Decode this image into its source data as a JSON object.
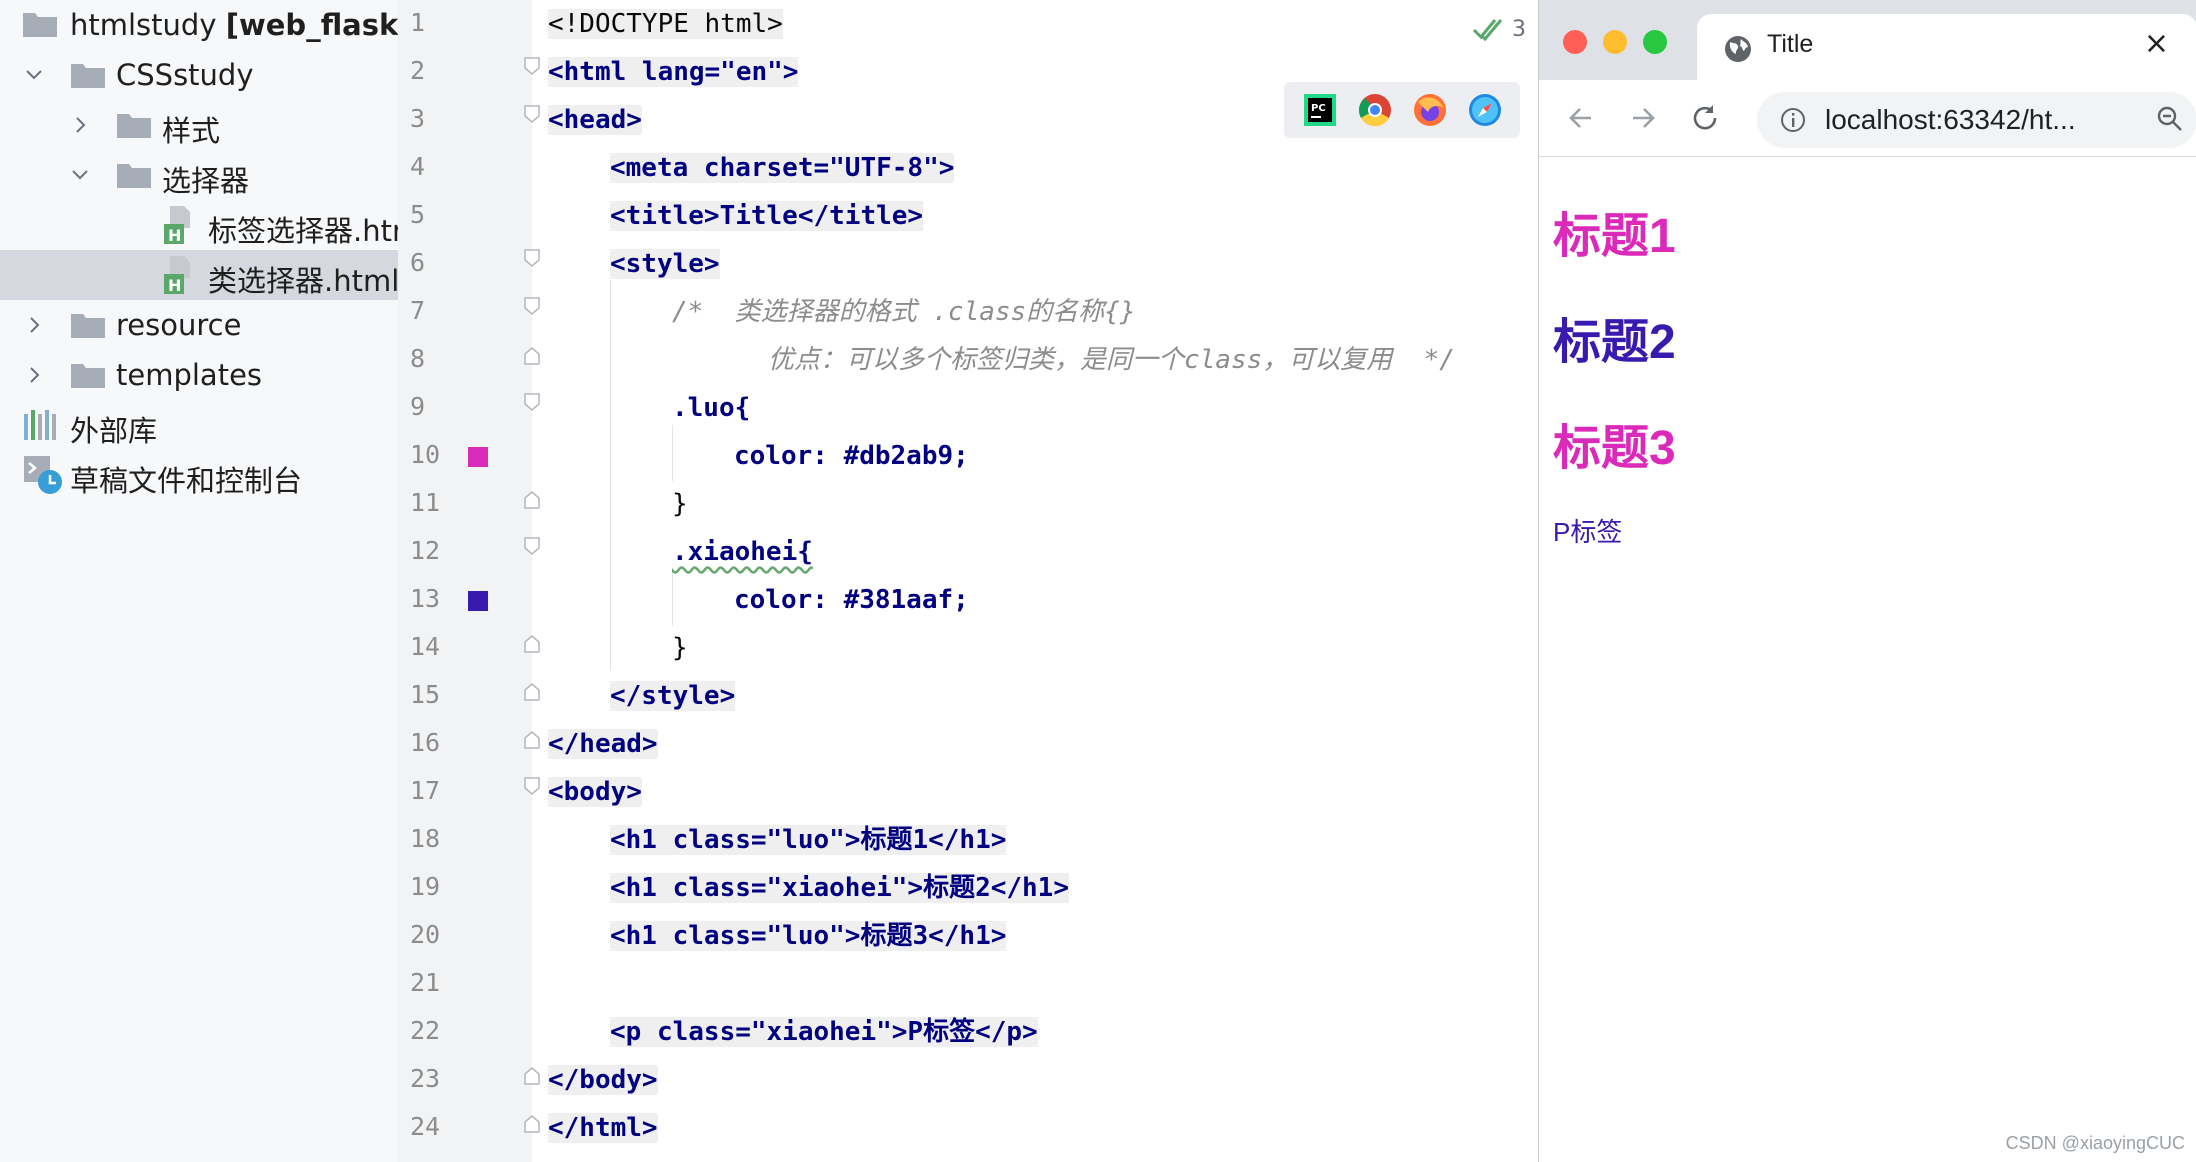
{
  "project_tree": {
    "root": {
      "name": "htmlstudy",
      "module": "[web_flask]"
    },
    "items": [
      {
        "label": "CSSstudy"
      },
      {
        "label": "样式"
      },
      {
        "label": "选择器"
      },
      {
        "label": "标签选择器.html"
      },
      {
        "label": "类选择器.html"
      },
      {
        "label": "resource"
      },
      {
        "label": "templates"
      },
      {
        "label": "外部库"
      },
      {
        "label": "草稿文件和控制台"
      }
    ]
  },
  "editor": {
    "inspection_count": "3",
    "colors": {
      "luo": "#db2ab9",
      "xiaohei": "#381aaf"
    },
    "code": {
      "l1": "<!DOCTYPE html>",
      "l2": "<html lang=\"en\">",
      "l3": "<head>",
      "l4": "<meta charset=\"UTF-8\">",
      "l5": "<title>Title</title>",
      "l6": "<style>",
      "l7": "/*  类选择器的格式 .class的名称{}",
      "l8": "优点：可以多个标签归类，是同一个class，可以复用  */",
      "l9": ".luo{",
      "l10": "color: #db2ab9;",
      "l11": "}",
      "l12": ".xiaohei{",
      "l13": "color: #381aaf;",
      "l14": "}",
      "l15": "</style>",
      "l16": "</head>",
      "l17": "<body>",
      "l18": "<h1 class=\"luo\">标题1</h1>",
      "l19": "<h1 class=\"xiaohei\">标题2</h1>",
      "l20": "<h1 class=\"luo\">标题3</h1>",
      "l21": "",
      "l22": "<p class=\"xiaohei\">P标签</p>",
      "l23": "</body>",
      "l24": "</html>"
    }
  },
  "browser": {
    "tab_title": "Title",
    "tab_close": "×",
    "url": "localhost:63342/ht...",
    "page": {
      "h1_1": "标题1",
      "h1_2": "标题2",
      "h1_3": "标题3",
      "p": "P标签"
    }
  },
  "watermark": "CSDN @xiaoyingCUC"
}
